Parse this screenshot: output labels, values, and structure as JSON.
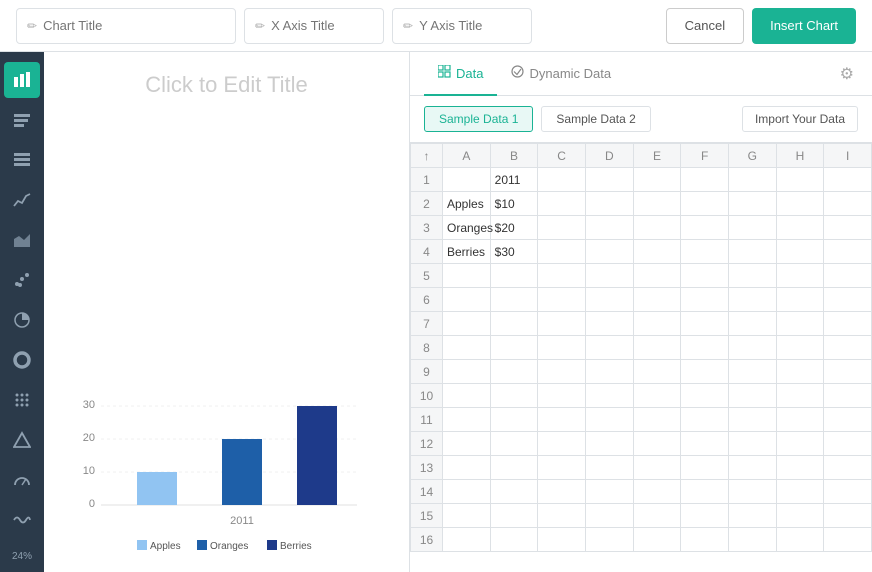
{
  "topbar": {
    "chart_title_placeholder": "Chart Title",
    "x_axis_placeholder": "X Axis Title",
    "y_axis_placeholder": "Y Axis Title",
    "cancel_label": "Cancel",
    "insert_label": "Insert Chart"
  },
  "sidebar": {
    "icons": [
      {
        "name": "bar-chart-icon",
        "symbol": "▐",
        "active": true
      },
      {
        "name": "bar-chart2-icon",
        "symbol": "▌",
        "active": false
      },
      {
        "name": "list-icon",
        "symbol": "≡",
        "active": false
      },
      {
        "name": "line-chart-icon",
        "symbol": "╱",
        "active": false
      },
      {
        "name": "area-chart-icon",
        "symbol": "∧",
        "active": false
      },
      {
        "name": "scatter-icon",
        "symbol": "⁘",
        "active": false
      },
      {
        "name": "pie-chart-icon",
        "symbol": "◕",
        "active": false
      },
      {
        "name": "donut-chart-icon",
        "symbol": "◎",
        "active": false
      },
      {
        "name": "dot-grid-icon",
        "symbol": "⠿",
        "active": false
      },
      {
        "name": "triangle-icon",
        "symbol": "△",
        "active": false
      },
      {
        "name": "gauge-icon",
        "symbol": "◷",
        "active": false
      },
      {
        "name": "wave-icon",
        "symbol": "∿",
        "active": false
      }
    ],
    "bottom_label": "24%"
  },
  "chart": {
    "title_placeholder": "Click to Edit Title",
    "x_label": "2011",
    "legend": [
      {
        "name": "Apples",
        "color": "#91c4f2"
      },
      {
        "name": "Oranges",
        "color": "#1e5fa8"
      },
      {
        "name": "Berries",
        "color": "#1e3a8a"
      }
    ],
    "bars": [
      {
        "label": "Apples",
        "value": 10,
        "color": "#91c4f2"
      },
      {
        "label": "Oranges",
        "value": 20,
        "color": "#1e5fa8"
      },
      {
        "label": "Berries",
        "value": 30,
        "color": "#1e3a8a"
      }
    ],
    "y_ticks": [
      0,
      10,
      20,
      30
    ],
    "max_value": 30
  },
  "panel": {
    "tabs": [
      {
        "label": "Data",
        "icon": "grid-icon",
        "active": true
      },
      {
        "label": "Dynamic Data",
        "icon": "dynamic-icon",
        "active": false
      }
    ],
    "sample_buttons": [
      {
        "label": "Sample Data 1",
        "active": true
      },
      {
        "label": "Sample Data 2",
        "active": false
      }
    ],
    "import_label": "Import Your Data",
    "columns": [
      "",
      "A",
      "B",
      "C",
      "D",
      "E",
      "F",
      "G",
      "H",
      "I"
    ],
    "rows": [
      {
        "row_num": 1,
        "A": "",
        "B": "2011",
        "C": "",
        "D": "",
        "E": "",
        "F": "",
        "G": "",
        "H": "",
        "I": ""
      },
      {
        "row_num": 2,
        "A": "Apples",
        "B": "$10",
        "C": "",
        "D": "",
        "E": "",
        "F": "",
        "G": "",
        "H": "",
        "I": ""
      },
      {
        "row_num": 3,
        "A": "Oranges",
        "B": "$20",
        "C": "",
        "D": "",
        "E": "",
        "F": "",
        "G": "",
        "H": "",
        "I": ""
      },
      {
        "row_num": 4,
        "A": "Berries",
        "B": "$30",
        "C": "",
        "D": "",
        "E": "",
        "F": "",
        "G": "",
        "H": "",
        "I": ""
      },
      {
        "row_num": 5,
        "A": "",
        "B": "",
        "C": "",
        "D": "",
        "E": "",
        "F": "",
        "G": "",
        "H": "",
        "I": ""
      },
      {
        "row_num": 6,
        "A": "",
        "B": "",
        "C": "",
        "D": "",
        "E": "",
        "F": "",
        "G": "",
        "H": "",
        "I": ""
      },
      {
        "row_num": 7,
        "A": "",
        "B": "",
        "C": "",
        "D": "",
        "E": "",
        "F": "",
        "G": "",
        "H": "",
        "I": ""
      },
      {
        "row_num": 8,
        "A": "",
        "B": "",
        "C": "",
        "D": "",
        "E": "",
        "F": "",
        "G": "",
        "H": "",
        "I": ""
      },
      {
        "row_num": 9,
        "A": "",
        "B": "",
        "C": "",
        "D": "",
        "E": "",
        "F": "",
        "G": "",
        "H": "",
        "I": ""
      },
      {
        "row_num": 10,
        "A": "",
        "B": "",
        "C": "",
        "D": "",
        "E": "",
        "F": "",
        "G": "",
        "H": "",
        "I": ""
      },
      {
        "row_num": 11,
        "A": "",
        "B": "",
        "C": "",
        "D": "",
        "E": "",
        "F": "",
        "G": "",
        "H": "",
        "I": ""
      },
      {
        "row_num": 12,
        "A": "",
        "B": "",
        "C": "",
        "D": "",
        "E": "",
        "F": "",
        "G": "",
        "H": "",
        "I": ""
      },
      {
        "row_num": 13,
        "A": "",
        "B": "",
        "C": "",
        "D": "",
        "E": "",
        "F": "",
        "G": "",
        "H": "",
        "I": ""
      },
      {
        "row_num": 14,
        "A": "",
        "B": "",
        "C": "",
        "D": "",
        "E": "",
        "F": "",
        "G": "",
        "H": "",
        "I": ""
      },
      {
        "row_num": 15,
        "A": "",
        "B": "",
        "C": "",
        "D": "",
        "E": "",
        "F": "",
        "G": "",
        "H": "",
        "I": ""
      },
      {
        "row_num": 16,
        "A": "",
        "B": "",
        "C": "",
        "D": "",
        "E": "",
        "F": "",
        "G": "",
        "H": "",
        "I": ""
      }
    ]
  }
}
